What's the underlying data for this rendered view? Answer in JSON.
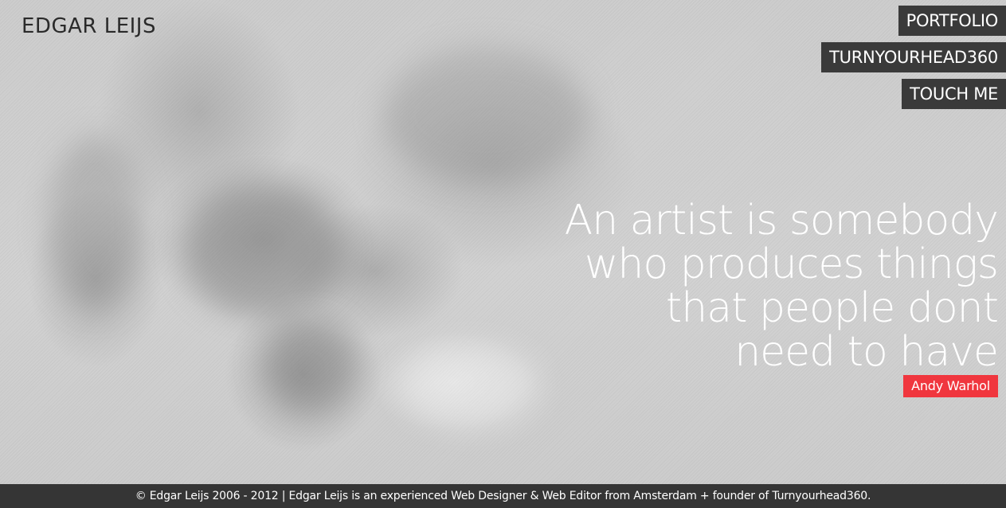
{
  "site": {
    "logo": "EDGAR LEIJS"
  },
  "nav": {
    "items": [
      {
        "label": "PORTFOLIO"
      },
      {
        "label": "TURNYOURHEAD360"
      },
      {
        "label": "TOUCH ME"
      }
    ]
  },
  "quote": {
    "lines": [
      "An artist is somebody",
      "who produces things",
      "that people dont",
      "need to have"
    ],
    "author": "Andy Warhol"
  },
  "footer": {
    "text": "© Edgar Leijs 2006 - 2012 | Edgar Leijs is an experienced Web Designer & Web Editor from Amsterdam + founder of Turnyourhead360."
  },
  "colors": {
    "nav_background": "#3a3a3a",
    "author_badge": "#f0363e",
    "footer_background": "#353535",
    "page_background": "#cfcfcf"
  }
}
